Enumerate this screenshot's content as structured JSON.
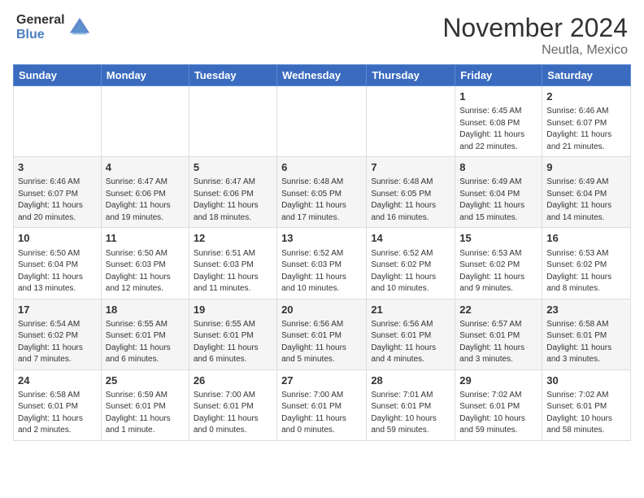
{
  "header": {
    "logo_general": "General",
    "logo_blue": "Blue",
    "month_title": "November 2024",
    "location": "Neutla, Mexico"
  },
  "days_of_week": [
    "Sunday",
    "Monday",
    "Tuesday",
    "Wednesday",
    "Thursday",
    "Friday",
    "Saturday"
  ],
  "weeks": [
    [
      {
        "day": "",
        "info": ""
      },
      {
        "day": "",
        "info": ""
      },
      {
        "day": "",
        "info": ""
      },
      {
        "day": "",
        "info": ""
      },
      {
        "day": "",
        "info": ""
      },
      {
        "day": "1",
        "info": "Sunrise: 6:45 AM\nSunset: 6:08 PM\nDaylight: 11 hours and 22 minutes."
      },
      {
        "day": "2",
        "info": "Sunrise: 6:46 AM\nSunset: 6:07 PM\nDaylight: 11 hours and 21 minutes."
      }
    ],
    [
      {
        "day": "3",
        "info": "Sunrise: 6:46 AM\nSunset: 6:07 PM\nDaylight: 11 hours and 20 minutes."
      },
      {
        "day": "4",
        "info": "Sunrise: 6:47 AM\nSunset: 6:06 PM\nDaylight: 11 hours and 19 minutes."
      },
      {
        "day": "5",
        "info": "Sunrise: 6:47 AM\nSunset: 6:06 PM\nDaylight: 11 hours and 18 minutes."
      },
      {
        "day": "6",
        "info": "Sunrise: 6:48 AM\nSunset: 6:05 PM\nDaylight: 11 hours and 17 minutes."
      },
      {
        "day": "7",
        "info": "Sunrise: 6:48 AM\nSunset: 6:05 PM\nDaylight: 11 hours and 16 minutes."
      },
      {
        "day": "8",
        "info": "Sunrise: 6:49 AM\nSunset: 6:04 PM\nDaylight: 11 hours and 15 minutes."
      },
      {
        "day": "9",
        "info": "Sunrise: 6:49 AM\nSunset: 6:04 PM\nDaylight: 11 hours and 14 minutes."
      }
    ],
    [
      {
        "day": "10",
        "info": "Sunrise: 6:50 AM\nSunset: 6:04 PM\nDaylight: 11 hours and 13 minutes."
      },
      {
        "day": "11",
        "info": "Sunrise: 6:50 AM\nSunset: 6:03 PM\nDaylight: 11 hours and 12 minutes."
      },
      {
        "day": "12",
        "info": "Sunrise: 6:51 AM\nSunset: 6:03 PM\nDaylight: 11 hours and 11 minutes."
      },
      {
        "day": "13",
        "info": "Sunrise: 6:52 AM\nSunset: 6:03 PM\nDaylight: 11 hours and 10 minutes."
      },
      {
        "day": "14",
        "info": "Sunrise: 6:52 AM\nSunset: 6:02 PM\nDaylight: 11 hours and 10 minutes."
      },
      {
        "day": "15",
        "info": "Sunrise: 6:53 AM\nSunset: 6:02 PM\nDaylight: 11 hours and 9 minutes."
      },
      {
        "day": "16",
        "info": "Sunrise: 6:53 AM\nSunset: 6:02 PM\nDaylight: 11 hours and 8 minutes."
      }
    ],
    [
      {
        "day": "17",
        "info": "Sunrise: 6:54 AM\nSunset: 6:02 PM\nDaylight: 11 hours and 7 minutes."
      },
      {
        "day": "18",
        "info": "Sunrise: 6:55 AM\nSunset: 6:01 PM\nDaylight: 11 hours and 6 minutes."
      },
      {
        "day": "19",
        "info": "Sunrise: 6:55 AM\nSunset: 6:01 PM\nDaylight: 11 hours and 6 minutes."
      },
      {
        "day": "20",
        "info": "Sunrise: 6:56 AM\nSunset: 6:01 PM\nDaylight: 11 hours and 5 minutes."
      },
      {
        "day": "21",
        "info": "Sunrise: 6:56 AM\nSunset: 6:01 PM\nDaylight: 11 hours and 4 minutes."
      },
      {
        "day": "22",
        "info": "Sunrise: 6:57 AM\nSunset: 6:01 PM\nDaylight: 11 hours and 3 minutes."
      },
      {
        "day": "23",
        "info": "Sunrise: 6:58 AM\nSunset: 6:01 PM\nDaylight: 11 hours and 3 minutes."
      }
    ],
    [
      {
        "day": "24",
        "info": "Sunrise: 6:58 AM\nSunset: 6:01 PM\nDaylight: 11 hours and 2 minutes."
      },
      {
        "day": "25",
        "info": "Sunrise: 6:59 AM\nSunset: 6:01 PM\nDaylight: 11 hours and 1 minute."
      },
      {
        "day": "26",
        "info": "Sunrise: 7:00 AM\nSunset: 6:01 PM\nDaylight: 11 hours and 0 minutes."
      },
      {
        "day": "27",
        "info": "Sunrise: 7:00 AM\nSunset: 6:01 PM\nDaylight: 11 hours and 0 minutes."
      },
      {
        "day": "28",
        "info": "Sunrise: 7:01 AM\nSunset: 6:01 PM\nDaylight: 10 hours and 59 minutes."
      },
      {
        "day": "29",
        "info": "Sunrise: 7:02 AM\nSunset: 6:01 PM\nDaylight: 10 hours and 59 minutes."
      },
      {
        "day": "30",
        "info": "Sunrise: 7:02 AM\nSunset: 6:01 PM\nDaylight: 10 hours and 58 minutes."
      }
    ]
  ]
}
